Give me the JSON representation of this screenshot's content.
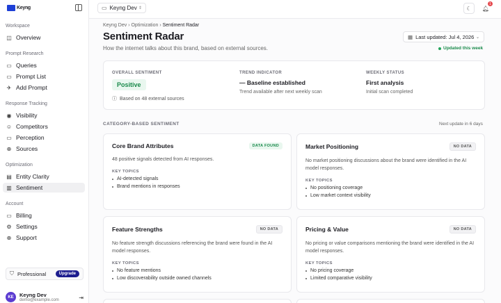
{
  "brand": {
    "logo_text": "Keyng"
  },
  "sidebar": {
    "sections": [
      {
        "label": "Workspace",
        "items": [
          {
            "label": "Overview",
            "icon": "grid-icon"
          }
        ]
      },
      {
        "label": "Prompt Research",
        "items": [
          {
            "label": "Queries",
            "icon": "chat-icon"
          },
          {
            "label": "Prompt List",
            "icon": "list-icon"
          },
          {
            "label": "Add Prompt",
            "icon": "rocket-icon"
          }
        ]
      },
      {
        "label": "Response Tracking",
        "items": [
          {
            "label": "Visibility",
            "icon": "eye-icon"
          },
          {
            "label": "Competitors",
            "icon": "users-icon"
          },
          {
            "label": "Perception",
            "icon": "chat-icon"
          },
          {
            "label": "Sources",
            "icon": "globe-icon"
          }
        ]
      },
      {
        "label": "Optimization",
        "items": [
          {
            "label": "Entity Clarity",
            "icon": "database-icon"
          },
          {
            "label": "Sentiment",
            "icon": "chart-icon",
            "active": true
          }
        ]
      },
      {
        "label": "Account",
        "items": [
          {
            "label": "Billing",
            "icon": "card-icon"
          },
          {
            "label": "Settings",
            "icon": "gear-icon"
          },
          {
            "label": "Support",
            "icon": "globe-icon"
          }
        ]
      }
    ],
    "plan": {
      "label": "Professional",
      "upgrade": "Upgrade"
    },
    "user": {
      "initials": "KE",
      "name": "Keyng Dev",
      "email": "demo@example.com"
    }
  },
  "topbar": {
    "workspace": "Keyng Dev",
    "notification_count": "1"
  },
  "page": {
    "breadcrumb": [
      "Keyng Dev",
      "Optimization",
      "Sentiment Radar"
    ],
    "title": "Sentiment Radar",
    "subtitle": "How the internet talks about this brand, based on external sources.",
    "last_updated": "Last updated: Jul 4, 2026",
    "updated_tag": "Updated this week"
  },
  "overall": {
    "overall_label": "OVERALL SENTIMENT",
    "overall_value": "Positive",
    "overall_note": "Based on 48 external sources",
    "trend_label": "TREND INDICATOR",
    "trend_value": "— Baseline established",
    "trend_note": "Trend available after next weekly scan",
    "weekly_label": "WEEKLY STATUS",
    "weekly_value": "First analysis",
    "weekly_note": "Initial scan completed"
  },
  "categories": {
    "heading": "CATEGORY-BASED SENTIMENT",
    "next_update": "Next update in 6 days",
    "key_topics_label": "KEY TOPICS",
    "cards": [
      {
        "title": "Core Brand Attributes",
        "tag": "DATA FOUND",
        "desc": "48 positive signals detected from AI responses.",
        "topics": [
          "AI-detected signals",
          "Brand mentions in responses"
        ]
      },
      {
        "title": "Market Positioning",
        "tag": "NO DATA",
        "desc": "No market positioning discussions about the brand were identified in the AI model responses.",
        "topics": [
          "No positioning coverage",
          "Low market context visibility"
        ]
      },
      {
        "title": "Feature Strengths",
        "tag": "NO DATA",
        "desc": "No feature strength discussions referencing the brand were found in the AI model responses.",
        "topics": [
          "No feature mentions",
          "Low discoverability outside owned channels"
        ]
      },
      {
        "title": "Pricing & Value",
        "tag": "NO DATA",
        "desc": "No pricing or value comparisons mentioning the brand were identified in the AI model responses.",
        "topics": [
          "No pricing coverage",
          "Limited comparative visibility"
        ]
      }
    ]
  }
}
